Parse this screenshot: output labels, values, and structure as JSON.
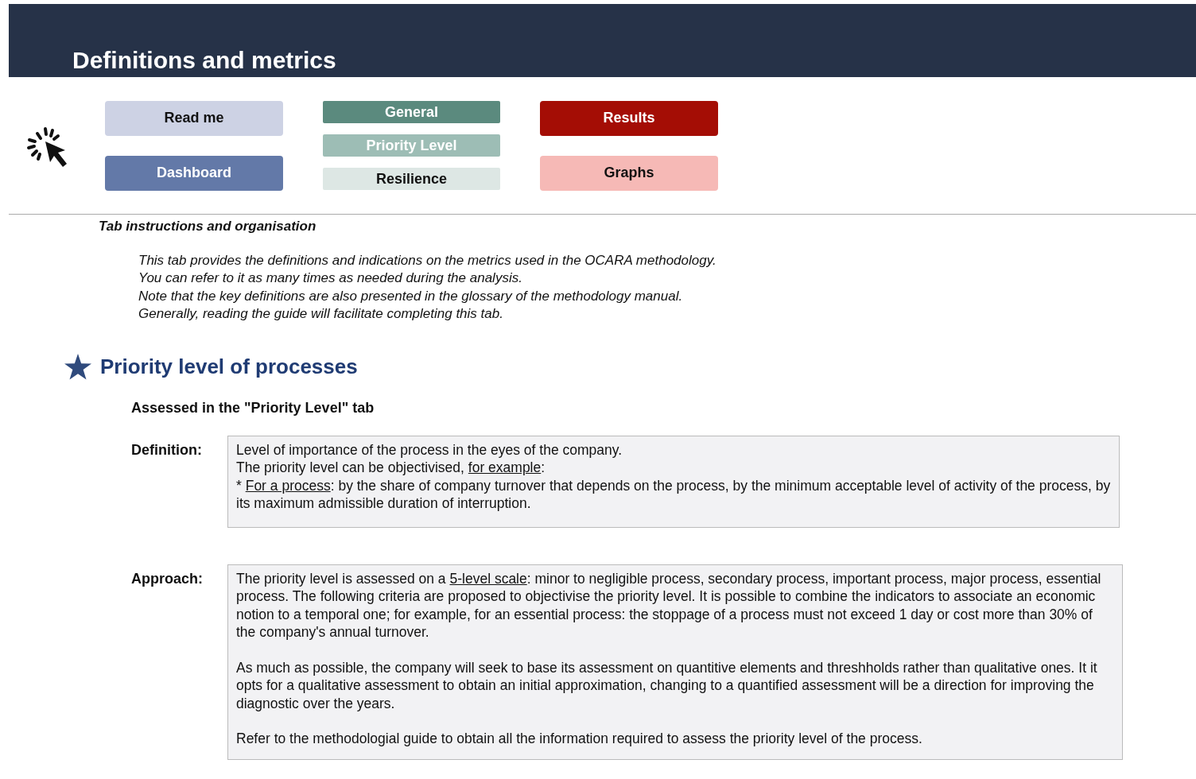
{
  "header": {
    "title": "Definitions and metrics"
  },
  "nav": {
    "columns": [
      [
        {
          "label": "Read me",
          "color": "#cdd2e4"
        },
        {
          "label": "Dashboard",
          "color": "#6379a8"
        }
      ],
      [
        {
          "label": "General",
          "color": "#5b8a7e"
        },
        {
          "label": "Priority Level",
          "color": "#9dbdb5"
        },
        {
          "label": "Resilience",
          "color": "#dde7e4"
        }
      ],
      [
        {
          "label": "Results",
          "color": "#a40d05"
        },
        {
          "label": "Graphs",
          "color": "#f6b9b6"
        }
      ]
    ]
  },
  "instructions": {
    "heading": "Tab instructions and organisation",
    "lines": [
      "This tab provides the definitions and indications on the metrics used in the OCARA methodology.",
      "You can refer to it as many times as needed during the analysis.",
      "Note that the key definitions are also presented in the glossary of the methodology manual.",
      "Generally, reading the guide will facilitate completing this tab."
    ]
  },
  "section": {
    "title": "Priority level of processes",
    "subtitle": "Assessed in the \"Priority Level\" tab",
    "fields": [
      {
        "label": "Definition:",
        "paragraphs": [
          [
            [
              {
                "text": "Level of importance of the process in the eyes of the company.",
                "underline": false
              }
            ],
            [
              {
                "text": "The priority level can be objectivised, ",
                "underline": false
              },
              {
                "text": "for example",
                "underline": true
              },
              {
                "text": ":",
                "underline": false
              }
            ],
            [
              {
                "text": "* ",
                "underline": false
              },
              {
                "text": "For a process",
                "underline": true
              },
              {
                "text": ": by the share of company turnover that depends on the process, by the minimum acceptable level of activity of the process, by its maximum admissible duration of interruption.",
                "underline": false
              }
            ]
          ]
        ]
      },
      {
        "label": "Approach:",
        "paragraphs": [
          [
            [
              {
                "text": "The priority level is assessed on a ",
                "underline": false
              },
              {
                "text": "5-level scale",
                "underline": true
              },
              {
                "text": ": minor to negligible process, secondary process, important process, major process, essential process. The following criteria are proposed to objectivise the priority level. It is possible to combine the indicators to associate an economic notion to a temporal one; for example, for an essential process: the stoppage of a process must not exceed 1 day or cost more than 30% of the company's annual turnover.",
                "underline": false
              }
            ]
          ],
          [
            [
              {
                "text": "As much as possible, the company will seek to base its assessment on quantitive elements and threshholds rather than qualitative ones. It it opts for a qualitative assessment to obtain an initial approximation, changing to a quantified assessment will be a direction for improving the diagnostic over the years.",
                "underline": false
              }
            ]
          ],
          [
            [
              {
                "text": "Refer to the  methodologial guide to obtain all the information required to assess the priority level of the process.",
                "underline": false
              }
            ]
          ]
        ]
      }
    ]
  }
}
